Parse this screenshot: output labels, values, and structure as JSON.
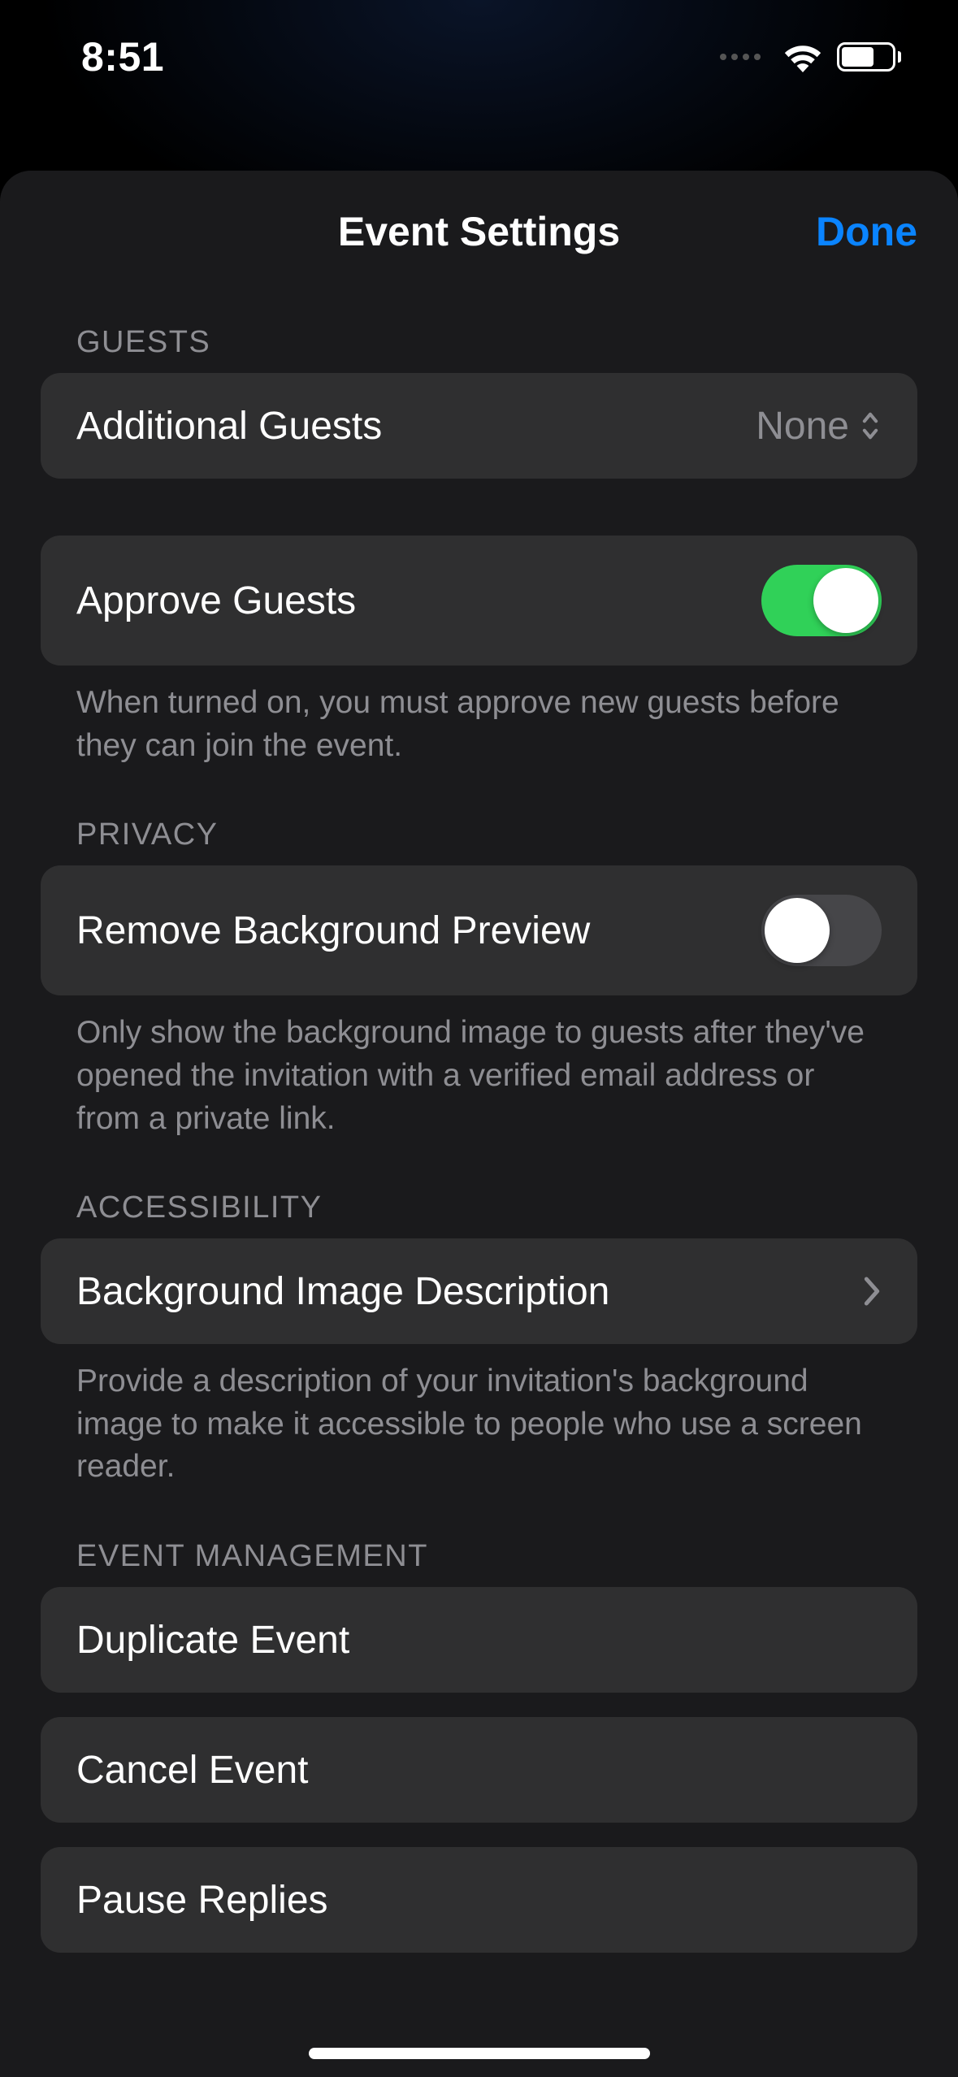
{
  "status": {
    "time": "8:51"
  },
  "header": {
    "title": "Event Settings",
    "done": "Done"
  },
  "sections": {
    "guests": {
      "header": "GUESTS",
      "additional_guests": {
        "label": "Additional Guests",
        "value": "None"
      },
      "approve_guests": {
        "label": "Approve Guests",
        "footer": "When turned on, you must approve new guests before they can join the event.",
        "on": true
      }
    },
    "privacy": {
      "header": "PRIVACY",
      "remove_bg_preview": {
        "label": "Remove Background Preview",
        "footer": "Only show the background image to guests after they've opened the invitation with a verified email address or from a private link.",
        "on": false
      }
    },
    "accessibility": {
      "header": "ACCESSIBILITY",
      "bg_image_desc": {
        "label": "Background Image Description",
        "footer": "Provide a description of your invitation's background image to make it accessible to people who use a screen reader."
      }
    },
    "event_mgmt": {
      "header": "EVENT MANAGEMENT",
      "duplicate": "Duplicate Event",
      "cancel": "Cancel Event",
      "pause": "Pause Replies"
    }
  }
}
